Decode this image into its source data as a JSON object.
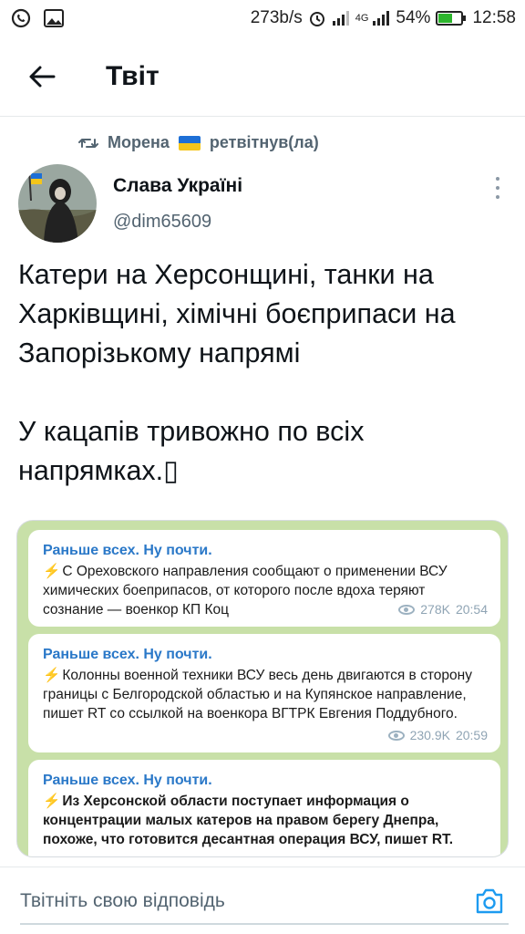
{
  "status_bar": {
    "network_speed": "273b/s",
    "network_type": "4G",
    "battery": "54%",
    "time": "12:58"
  },
  "header": {
    "title": "Твіт"
  },
  "retweet": {
    "user": "Морена",
    "action": "ретвітнув(ла)"
  },
  "author": {
    "name": "Слава Україні",
    "handle": "@dim65609"
  },
  "tweet": {
    "paragraphs": [
      "Катери на Херсонщині, танки на Харківщині, хімічні боєприпаси на Запорізькому напрямі",
      "У кацапів тривожно по всіх напрямках.▯"
    ]
  },
  "media": {
    "messages": [
      {
        "source": "Раньше всех. Ну почти.",
        "text": "С Ореховского направления сообщают о применении ВСУ химических боеприпасов, от которого после вдоха теряют сознание — военкор КП Коц",
        "views": "278K",
        "time": "20:54"
      },
      {
        "source": "Раньше всех. Ну почти.",
        "text": "Колонны военной техники ВСУ весь день двигаются в сторону границы с Белгородской областью и на Купянское направление, пишет RT со ссылкой на военкора ВГТРК Евгения Поддубного.",
        "views": "230.9K",
        "time": "20:59"
      },
      {
        "source": "Раньше всех. Ну почти.",
        "text": "Из Херсонской области поступает информация о концентрации малых катеров на правом берегу Днепра, похоже, что готовится десантная операция ВСУ, пишет RT."
      }
    ]
  },
  "reply": {
    "placeholder": "Твітніть свою відповідь"
  },
  "colors": {
    "accent": "#1d9bf0",
    "telegram_link": "#2a78c8",
    "bolt": "#f2a51a",
    "muted": "#536471"
  }
}
